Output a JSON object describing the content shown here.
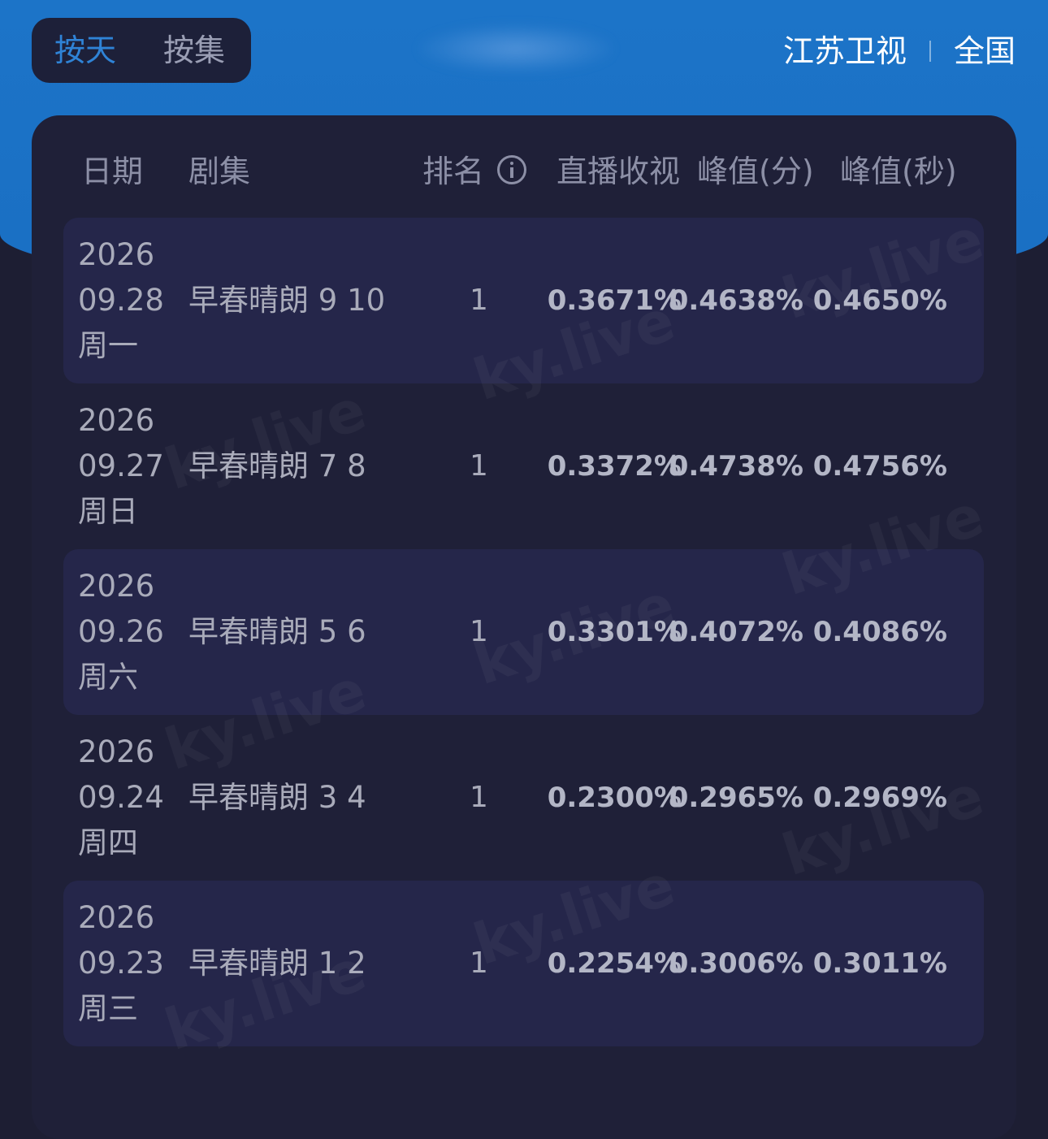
{
  "header": {
    "toggle": {
      "by_day": "按天",
      "by_episode": "按集"
    },
    "channel": "江苏卫视",
    "region": "全国"
  },
  "table": {
    "columns": {
      "date": "日期",
      "episode": "剧集",
      "rank": "排名",
      "live_rating": "直播收视",
      "peak_minute": "峰值(分)",
      "peak_second": "峰值(秒)"
    },
    "rows": [
      {
        "year": "2026",
        "date": "09.28",
        "weekday": "周一",
        "episode": "早春晴朗 9 10",
        "rank": "1",
        "live_rating": "0.3671%",
        "peak_minute": "0.4638%",
        "peak_second": "0.4650%"
      },
      {
        "year": "2026",
        "date": "09.27",
        "weekday": "周日",
        "episode": "早春晴朗 7 8",
        "rank": "1",
        "live_rating": "0.3372%",
        "peak_minute": "0.4738%",
        "peak_second": "0.4756%"
      },
      {
        "year": "2026",
        "date": "09.26",
        "weekday": "周六",
        "episode": "早春晴朗 5 6",
        "rank": "1",
        "live_rating": "0.3301%",
        "peak_minute": "0.4072%",
        "peak_second": "0.4086%"
      },
      {
        "year": "2026",
        "date": "09.24",
        "weekday": "周四",
        "episode": "早春晴朗 3 4",
        "rank": "1",
        "live_rating": "0.2300%",
        "peak_minute": "0.2965%",
        "peak_second": "0.2969%"
      },
      {
        "year": "2026",
        "date": "09.23",
        "weekday": "周三",
        "episode": "早春晴朗 1 2",
        "rank": "1",
        "live_rating": "0.2254%",
        "peak_minute": "0.3006%",
        "peak_second": "0.3011%"
      }
    ]
  },
  "watermark": "ky.live"
}
